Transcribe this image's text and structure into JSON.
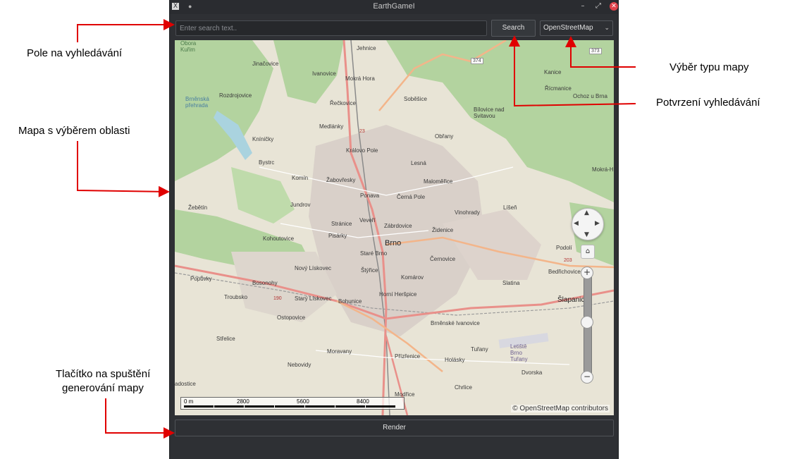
{
  "window": {
    "title": "EarthGameI",
    "app_icon": "X",
    "minimize_icon": "–",
    "maximize_icon": "⤢",
    "close_icon": "✕"
  },
  "toolbar": {
    "search_placeholder": "Enter search text..",
    "search_value": "",
    "search_label": "Search",
    "map_type_selected": "OpenStreetMap"
  },
  "map": {
    "city": "Brno",
    "places": [
      "Jehnice",
      "Jinačovice",
      "Ivanovice",
      "Mokrá Hora",
      "Soběšice",
      "Kanice",
      "Řícmanice",
      "Rozdrojovice",
      "Řečkovice",
      "Ochoz u Brna",
      "Bílovice nad Svitavou",
      "Medlánky",
      "Kníničky",
      "Královo Pole",
      "Obřany",
      "Bystrc",
      "Lesná",
      "Komín",
      "Žabovřesky",
      "Maloměřice",
      "Mokrá-Ho",
      "Ponava",
      "Černá Pole",
      "Žebětín",
      "Jundrov",
      "Vinohrady",
      "Líšeň",
      "Veveří",
      "Stránice",
      "Zábrdovice",
      "Pisárky",
      "Židenice",
      "Kohoutovice",
      "Staré Brno",
      "Podolí",
      "Černovice",
      "Štýřice",
      "Nový Lískovec",
      "Bedřichovice",
      "Komárov",
      "Bosonohy",
      "Popůvky",
      "Starý Lískovec",
      "Slatina",
      "Troubsko",
      "Bohunice",
      "Horní Heršpice",
      "Šlapanice",
      "Ostopovice",
      "Brněnské Ivanovice",
      "Střelice",
      "Moravany",
      "Letiště Brno Tuřany",
      "Tuřany",
      "Přízřenice",
      "Holásky",
      "Nebovidy",
      "Dvorska",
      "Chrlice",
      "adostice",
      "Modřice",
      "Brněnská přehrada",
      "Obora Kuřim"
    ],
    "road_numbers": [
      "374",
      "373",
      "190",
      "203",
      "23"
    ],
    "scale_labels": [
      "0 m",
      "2800",
      "5600",
      "8400"
    ],
    "attribution": "© OpenStreetMap contributors",
    "controls": {
      "home_icon": "⌂",
      "zoom_in": "+",
      "zoom_out": "−",
      "zoom_level": 0.55
    }
  },
  "render_label": "Render",
  "annotations": {
    "search_field": "Pole na vyhledávání",
    "map_type": "Výběr typu mapy",
    "search_confirm": "Potvrzení vyhledávání",
    "map_area": "Mapa s výběrem oblasti",
    "render_line1": "Tlačítko na spuštění",
    "render_line2": "generování mapy"
  },
  "colors": {
    "window_bg": "#2e3034",
    "annotation_arrow": "#e00000",
    "forest": "#aed1a0",
    "land": "#e8e4d6",
    "urban": "#d9d0c9",
    "major_road": "#e9908a"
  }
}
